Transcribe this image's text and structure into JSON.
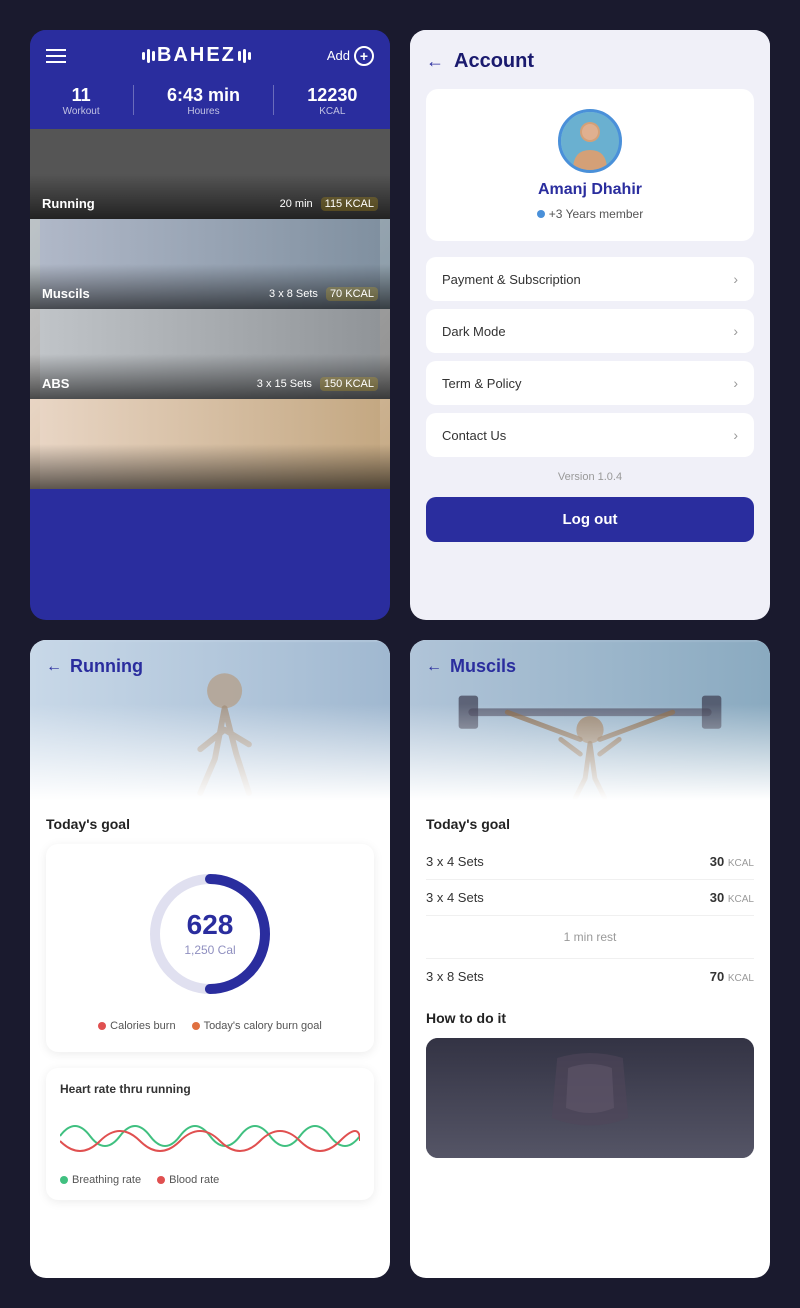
{
  "app": {
    "logo_text": "BAHEZ",
    "add_label": "Add",
    "stats": [
      {
        "value": "11",
        "label": "Workout"
      },
      {
        "value": "6:43 min",
        "label": "Houres"
      },
      {
        "value": "12230",
        "label": "KCAL"
      }
    ],
    "workout_cards": [
      {
        "id": "running",
        "title": "Running",
        "meta1": "20 min",
        "meta2": "115",
        "meta2_unit": "KCAL"
      },
      {
        "id": "muscils",
        "title": "Muscils",
        "meta1": "3 x 8 Sets",
        "meta2": "70",
        "meta2_unit": "KCAL"
      },
      {
        "id": "abs",
        "title": "ABS",
        "meta1": "3 x 15 Sets",
        "meta2": "150",
        "meta2_unit": "KCAL"
      },
      {
        "id": "last",
        "title": "",
        "meta1": "",
        "meta2": "",
        "meta2_unit": ""
      }
    ]
  },
  "account": {
    "back_label": "←",
    "title": "Account",
    "profile": {
      "name": "Amanj Dhahir",
      "member_label": "+3 Years member"
    },
    "menu_items": [
      {
        "label": "Payment & Subscription"
      },
      {
        "label": "Dark Mode"
      },
      {
        "label": "Term & Policy"
      },
      {
        "label": "Contact Us"
      }
    ],
    "version": "Version 1.0.4",
    "logout_label": "Log out"
  },
  "running": {
    "back_label": "←",
    "title": "Running",
    "todays_goal_label": "Today's goal",
    "donut": {
      "value": "628",
      "unit": "1,250  Cal",
      "progress": 0.5,
      "radius": 55,
      "stroke_width": 10,
      "color_bg": "#e0e0f0",
      "color_fill": "#2a2d9e"
    },
    "legend": [
      {
        "label": "Calories burn",
        "color": "#e05050"
      },
      {
        "label": "Today's calory burn goal",
        "color": "#e07040"
      }
    ],
    "heart_rate_title": "Heart rate thru running",
    "hr_legend": [
      {
        "label": "Breathing rate",
        "color": "#40c080"
      },
      {
        "label": "Blood rate",
        "color": "#e05050"
      }
    ]
  },
  "muscils": {
    "back_label": "←",
    "title": "Muscils",
    "todays_goal_label": "Today's goal",
    "sets": [
      {
        "label": "3 x 4 Sets",
        "kcal": "30",
        "kcal_unit": "KCAL"
      },
      {
        "label": "3 x 4 Sets",
        "kcal": "30",
        "kcal_unit": "KCAL"
      },
      {
        "rest": "1 min rest"
      },
      {
        "label": "3 x 8 Sets",
        "kcal": "70",
        "kcal_unit": "KCAL"
      }
    ],
    "how_to_label": "How to do it"
  }
}
